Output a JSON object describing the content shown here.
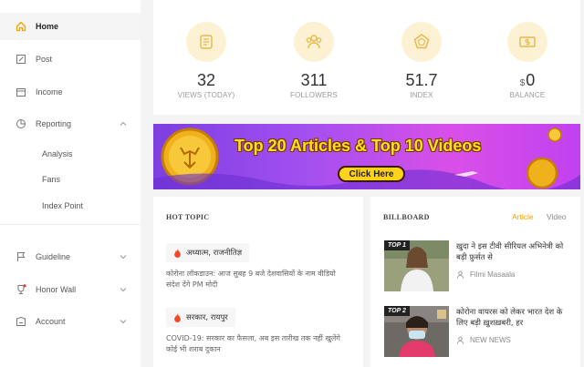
{
  "sidebar": {
    "items": [
      {
        "label": "Home"
      },
      {
        "label": "Post"
      },
      {
        "label": "Income"
      },
      {
        "label": "Reporting"
      },
      {
        "label": "Guideline"
      },
      {
        "label": "Honor Wall"
      },
      {
        "label": "Account"
      }
    ],
    "reporting_sub": [
      "Analysis",
      "Fans",
      "Index Point"
    ]
  },
  "stats": [
    {
      "value": "32",
      "caption": "VIEWS  (TODAY)",
      "icon": "scroll-icon"
    },
    {
      "value": "311",
      "caption": "FOLLOWERS",
      "icon": "followers-icon"
    },
    {
      "value": "51.7",
      "caption": "INDEX",
      "icon": "radar-icon"
    },
    {
      "currency": "$",
      "value": "0",
      "caption": "BALANCE",
      "icon": "money-icon"
    }
  ],
  "banner": {
    "title": "Top 20 Articles & Top 10 Videos",
    "button": "Click Here"
  },
  "hot_topic": {
    "title": "HOT TOPIC",
    "topics": [
      {
        "tag": "अध्यात्म, राजनीतिज्ञ",
        "text": "कोरोना लॉकडाउन: आज सुबह 9 बजे देशवासियों के नाम वीडियो संदेश देंगे PM मोदी"
      },
      {
        "tag": "सरकार, रायपुर",
        "text": "COVID-19: सरकार का फैसला, अब इस तारीख तक नहीं खुलेंगे कोई भी शराब दुकान"
      }
    ]
  },
  "billboard": {
    "title": "BILLBOARD",
    "tabs": [
      "Article",
      "Video"
    ],
    "items": [
      {
        "badge": "TOP 1",
        "title": "ख़ुदा ने इस टीवी सीरियल अभिनेत्री को बड़ी फ़ुर्सत से",
        "source": "Filmi Masaala"
      },
      {
        "badge": "TOP 2",
        "title": "कोरोना वायरस को लेकर भारत देश के लिए बड़ी ख़ुशख़बरी, हर",
        "source": "NEW NEWS"
      }
    ]
  },
  "colors": {
    "accent": "#f2a200",
    "icon_circle": "#fdf1d4",
    "banner_gold": "#ffe21a"
  }
}
